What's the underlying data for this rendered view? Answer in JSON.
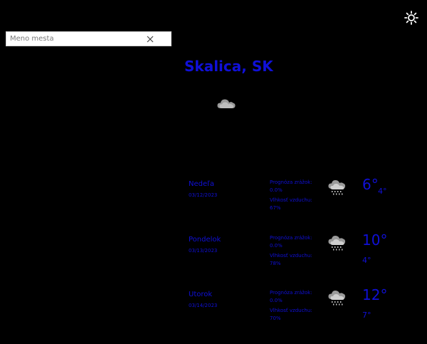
{
  "search": {
    "placeholder": "Meno mesta",
    "value": ""
  },
  "icons": {
    "settings": "gear-icon",
    "clear": "close-icon",
    "current": "cloud-icon",
    "forecast": "cloud-rain-icon"
  },
  "colors": {
    "background": "#000000",
    "accent": "#1010d8"
  },
  "location": {
    "title": "Skalica, SK"
  },
  "forecast": [
    {
      "name": "Nedeľa",
      "date": "03/12/2023",
      "rain": "Prognóza zrážok: 0.0%",
      "humidity": "Vlhkosť vzduchu: 67%",
      "high": "6°",
      "low": "4°"
    },
    {
      "name": "Pondelok",
      "date": "03/13/2023",
      "rain": "Prognóza zrážok: 0.0%",
      "humidity": "Vlhkosť vzduchu: 78%",
      "high": "10°",
      "low": "4°"
    },
    {
      "name": "Utorok",
      "date": "03/14/2023",
      "rain": "Prognóza zrážok: 0.0%",
      "humidity": "Vlhkosť vzduchu: 70%",
      "high": "12°",
      "low": "7°"
    }
  ]
}
